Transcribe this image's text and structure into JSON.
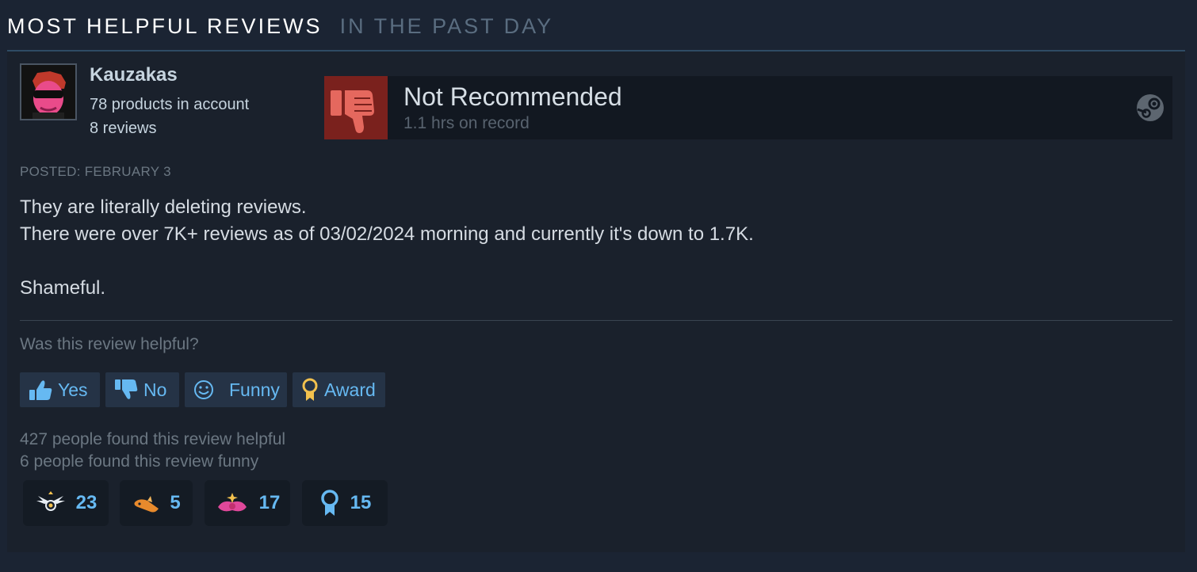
{
  "section": {
    "title": "MOST HELPFUL REVIEWS",
    "subtitle": "IN THE PAST DAY"
  },
  "review": {
    "author": {
      "username": "Kauzakas",
      "products": "78 products in account",
      "reviews": "8 reviews",
      "avatar_icon": "avatar-pink-sunglasses"
    },
    "verdict": {
      "label": "Not Recommended",
      "hours": "1.1 hrs on record",
      "icon": "thumbs-down-icon",
      "platform_icon": "steam-icon"
    },
    "posted": "POSTED: FEBRUARY 3",
    "body": [
      "They are literally deleting reviews.",
      "There were over 7K+ reviews as of 03/02/2024 morning and currently it's down to 1.7K.",
      "",
      "Shameful."
    ],
    "helpful_prompt": "Was this review helpful?",
    "buttons": {
      "yes": "Yes",
      "no": "No",
      "funny": "Funny",
      "award": "Award"
    },
    "found_helpful": "427 people found this review helpful",
    "found_funny": "6 people found this review funny",
    "awards": [
      {
        "icon": "winged-emblem-icon",
        "count": "23"
      },
      {
        "icon": "orange-horn-icon",
        "count": "5"
      },
      {
        "icon": "pink-sparkle-icon",
        "count": "17"
      },
      {
        "icon": "ribbon-medal-icon",
        "count": "15"
      }
    ]
  },
  "colors": {
    "background": "#1b2433",
    "card": "#1a212c",
    "accent_blue": "#66b9f2",
    "not_recommended_tile": "#7a211d",
    "thumb_down_fill": "#e5685e"
  }
}
